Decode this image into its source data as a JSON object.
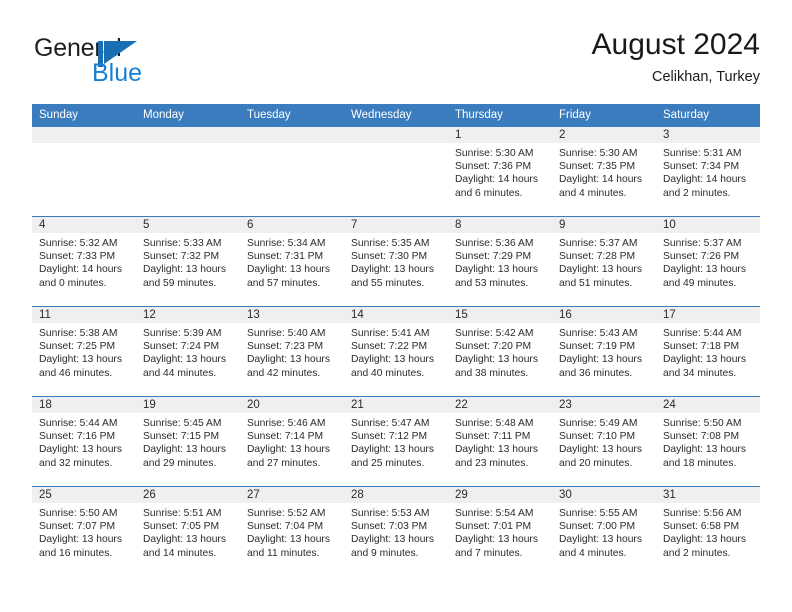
{
  "brand": {
    "name_top": "General",
    "name_bottom": "Blue",
    "mark": "blue-triangle-logo",
    "color_dark": "#231f20",
    "color_blue": "#1a7fd4"
  },
  "header": {
    "title": "August 2024",
    "subtitle": "Celikhan, Turkey"
  },
  "theme": {
    "header_blue": "#3a7cbe",
    "band_gray": "#efefef",
    "text": "#2b2b2b"
  },
  "calendar": {
    "weekdays": [
      "Sunday",
      "Monday",
      "Tuesday",
      "Wednesday",
      "Thursday",
      "Friday",
      "Saturday"
    ],
    "weeks": [
      [
        {
          "day": "",
          "empty": true
        },
        {
          "day": "",
          "empty": true
        },
        {
          "day": "",
          "empty": true
        },
        {
          "day": "",
          "empty": true
        },
        {
          "day": "1",
          "sunrise": "Sunrise: 5:30 AM",
          "sunset": "Sunset: 7:36 PM",
          "daylight": "Daylight: 14 hours and 6 minutes."
        },
        {
          "day": "2",
          "sunrise": "Sunrise: 5:30 AM",
          "sunset": "Sunset: 7:35 PM",
          "daylight": "Daylight: 14 hours and 4 minutes."
        },
        {
          "day": "3",
          "sunrise": "Sunrise: 5:31 AM",
          "sunset": "Sunset: 7:34 PM",
          "daylight": "Daylight: 14 hours and 2 minutes."
        }
      ],
      [
        {
          "day": "4",
          "sunrise": "Sunrise: 5:32 AM",
          "sunset": "Sunset: 7:33 PM",
          "daylight": "Daylight: 14 hours and 0 minutes."
        },
        {
          "day": "5",
          "sunrise": "Sunrise: 5:33 AM",
          "sunset": "Sunset: 7:32 PM",
          "daylight": "Daylight: 13 hours and 59 minutes."
        },
        {
          "day": "6",
          "sunrise": "Sunrise: 5:34 AM",
          "sunset": "Sunset: 7:31 PM",
          "daylight": "Daylight: 13 hours and 57 minutes."
        },
        {
          "day": "7",
          "sunrise": "Sunrise: 5:35 AM",
          "sunset": "Sunset: 7:30 PM",
          "daylight": "Daylight: 13 hours and 55 minutes."
        },
        {
          "day": "8",
          "sunrise": "Sunrise: 5:36 AM",
          "sunset": "Sunset: 7:29 PM",
          "daylight": "Daylight: 13 hours and 53 minutes."
        },
        {
          "day": "9",
          "sunrise": "Sunrise: 5:37 AM",
          "sunset": "Sunset: 7:28 PM",
          "daylight": "Daylight: 13 hours and 51 minutes."
        },
        {
          "day": "10",
          "sunrise": "Sunrise: 5:37 AM",
          "sunset": "Sunset: 7:26 PM",
          "daylight": "Daylight: 13 hours and 49 minutes."
        }
      ],
      [
        {
          "day": "11",
          "sunrise": "Sunrise: 5:38 AM",
          "sunset": "Sunset: 7:25 PM",
          "daylight": "Daylight: 13 hours and 46 minutes."
        },
        {
          "day": "12",
          "sunrise": "Sunrise: 5:39 AM",
          "sunset": "Sunset: 7:24 PM",
          "daylight": "Daylight: 13 hours and 44 minutes."
        },
        {
          "day": "13",
          "sunrise": "Sunrise: 5:40 AM",
          "sunset": "Sunset: 7:23 PM",
          "daylight": "Daylight: 13 hours and 42 minutes."
        },
        {
          "day": "14",
          "sunrise": "Sunrise: 5:41 AM",
          "sunset": "Sunset: 7:22 PM",
          "daylight": "Daylight: 13 hours and 40 minutes."
        },
        {
          "day": "15",
          "sunrise": "Sunrise: 5:42 AM",
          "sunset": "Sunset: 7:20 PM",
          "daylight": "Daylight: 13 hours and 38 minutes."
        },
        {
          "day": "16",
          "sunrise": "Sunrise: 5:43 AM",
          "sunset": "Sunset: 7:19 PM",
          "daylight": "Daylight: 13 hours and 36 minutes."
        },
        {
          "day": "17",
          "sunrise": "Sunrise: 5:44 AM",
          "sunset": "Sunset: 7:18 PM",
          "daylight": "Daylight: 13 hours and 34 minutes."
        }
      ],
      [
        {
          "day": "18",
          "sunrise": "Sunrise: 5:44 AM",
          "sunset": "Sunset: 7:16 PM",
          "daylight": "Daylight: 13 hours and 32 minutes."
        },
        {
          "day": "19",
          "sunrise": "Sunrise: 5:45 AM",
          "sunset": "Sunset: 7:15 PM",
          "daylight": "Daylight: 13 hours and 29 minutes."
        },
        {
          "day": "20",
          "sunrise": "Sunrise: 5:46 AM",
          "sunset": "Sunset: 7:14 PM",
          "daylight": "Daylight: 13 hours and 27 minutes."
        },
        {
          "day": "21",
          "sunrise": "Sunrise: 5:47 AM",
          "sunset": "Sunset: 7:12 PM",
          "daylight": "Daylight: 13 hours and 25 minutes."
        },
        {
          "day": "22",
          "sunrise": "Sunrise: 5:48 AM",
          "sunset": "Sunset: 7:11 PM",
          "daylight": "Daylight: 13 hours and 23 minutes."
        },
        {
          "day": "23",
          "sunrise": "Sunrise: 5:49 AM",
          "sunset": "Sunset: 7:10 PM",
          "daylight": "Daylight: 13 hours and 20 minutes."
        },
        {
          "day": "24",
          "sunrise": "Sunrise: 5:50 AM",
          "sunset": "Sunset: 7:08 PM",
          "daylight": "Daylight: 13 hours and 18 minutes."
        }
      ],
      [
        {
          "day": "25",
          "sunrise": "Sunrise: 5:50 AM",
          "sunset": "Sunset: 7:07 PM",
          "daylight": "Daylight: 13 hours and 16 minutes."
        },
        {
          "day": "26",
          "sunrise": "Sunrise: 5:51 AM",
          "sunset": "Sunset: 7:05 PM",
          "daylight": "Daylight: 13 hours and 14 minutes."
        },
        {
          "day": "27",
          "sunrise": "Sunrise: 5:52 AM",
          "sunset": "Sunset: 7:04 PM",
          "daylight": "Daylight: 13 hours and 11 minutes."
        },
        {
          "day": "28",
          "sunrise": "Sunrise: 5:53 AM",
          "sunset": "Sunset: 7:03 PM",
          "daylight": "Daylight: 13 hours and 9 minutes."
        },
        {
          "day": "29",
          "sunrise": "Sunrise: 5:54 AM",
          "sunset": "Sunset: 7:01 PM",
          "daylight": "Daylight: 13 hours and 7 minutes."
        },
        {
          "day": "30",
          "sunrise": "Sunrise: 5:55 AM",
          "sunset": "Sunset: 7:00 PM",
          "daylight": "Daylight: 13 hours and 4 minutes."
        },
        {
          "day": "31",
          "sunrise": "Sunrise: 5:56 AM",
          "sunset": "Sunset: 6:58 PM",
          "daylight": "Daylight: 13 hours and 2 minutes."
        }
      ]
    ]
  }
}
